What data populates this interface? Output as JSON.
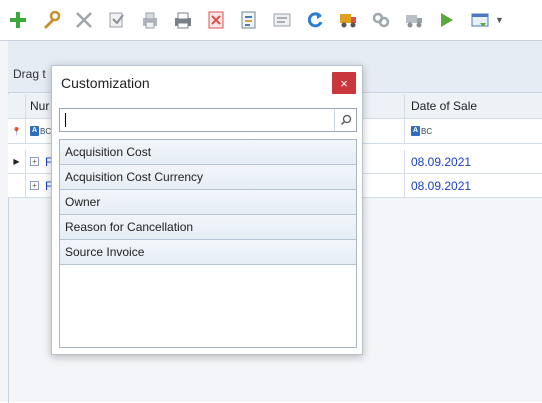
{
  "toolbar": {
    "buttons": [
      {
        "name": "add-icon",
        "color": "#3aa83a"
      },
      {
        "name": "edit-icon",
        "color": "#d89a2a"
      },
      {
        "name": "delete-icon",
        "color": "#9aa0a6"
      },
      {
        "name": "copy-icon",
        "color": "#9aa0a6"
      },
      {
        "name": "print-preview-icon",
        "color": "#9aa0a6"
      },
      {
        "name": "print-icon",
        "color": "#7a8088"
      },
      {
        "name": "cancel-document-icon",
        "color": "#d9534f"
      },
      {
        "name": "export-icon",
        "color": "#4a7bbf"
      },
      {
        "name": "document-icon",
        "color": "#9aa0a6"
      },
      {
        "name": "refresh-icon",
        "color": "#2b7cd3"
      },
      {
        "name": "truck-icon",
        "color": "#e0a020"
      },
      {
        "name": "link-icon",
        "color": "#9aa0a6"
      },
      {
        "name": "delivery-icon",
        "color": "#9aa0a6"
      },
      {
        "name": "run-icon",
        "color": "#5aa83a"
      },
      {
        "name": "view-icon",
        "color": "#4a7bbf"
      }
    ]
  },
  "grid": {
    "group_hint": "Drag t",
    "columns": {
      "number": "Nur",
      "date_of_sale": "Date of Sale"
    },
    "filter_abc": "BC",
    "rows": [
      {
        "number": "F",
        "date_of_sale": "08.09.2021"
      },
      {
        "number": "F",
        "date_of_sale": "08.09.2021"
      }
    ]
  },
  "dialog": {
    "title": "Customization",
    "close_label": "×",
    "search": {
      "value": "",
      "placeholder": ""
    },
    "items": [
      "Acquisition Cost",
      "Acquisition Cost Currency",
      "Owner",
      "Reason for Cancellation",
      "Source Invoice"
    ]
  }
}
